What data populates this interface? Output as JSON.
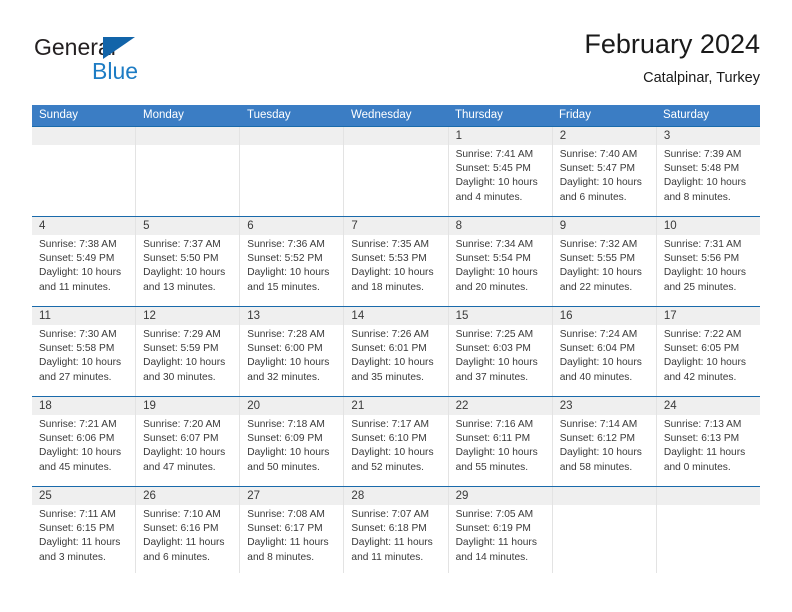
{
  "brand": {
    "name_top": "General",
    "name_bottom": "Blue",
    "accent_color": "#1d7cc4",
    "triangle_color": "#1264a9"
  },
  "header": {
    "title": "February 2024",
    "subtitle": "Catalpinar, Turkey"
  },
  "calendar": {
    "header_bg": "#3b7dc4",
    "row_rule_color": "#1a6aab",
    "date_band_bg": "#efefef",
    "weekdays": [
      "Sunday",
      "Monday",
      "Tuesday",
      "Wednesday",
      "Thursday",
      "Friday",
      "Saturday"
    ],
    "weeks": [
      [
        {
          "day": "",
          "empty": true
        },
        {
          "day": "",
          "empty": true
        },
        {
          "day": "",
          "empty": true
        },
        {
          "day": "",
          "empty": true
        },
        {
          "day": "1",
          "sunrise": "Sunrise: 7:41 AM",
          "sunset": "Sunset: 5:45 PM",
          "daylight": "Daylight: 10 hours and 4 minutes."
        },
        {
          "day": "2",
          "sunrise": "Sunrise: 7:40 AM",
          "sunset": "Sunset: 5:47 PM",
          "daylight": "Daylight: 10 hours and 6 minutes."
        },
        {
          "day": "3",
          "sunrise": "Sunrise: 7:39 AM",
          "sunset": "Sunset: 5:48 PM",
          "daylight": "Daylight: 10 hours and 8 minutes."
        }
      ],
      [
        {
          "day": "4",
          "sunrise": "Sunrise: 7:38 AM",
          "sunset": "Sunset: 5:49 PM",
          "daylight": "Daylight: 10 hours and 11 minutes."
        },
        {
          "day": "5",
          "sunrise": "Sunrise: 7:37 AM",
          "sunset": "Sunset: 5:50 PM",
          "daylight": "Daylight: 10 hours and 13 minutes."
        },
        {
          "day": "6",
          "sunrise": "Sunrise: 7:36 AM",
          "sunset": "Sunset: 5:52 PM",
          "daylight": "Daylight: 10 hours and 15 minutes."
        },
        {
          "day": "7",
          "sunrise": "Sunrise: 7:35 AM",
          "sunset": "Sunset: 5:53 PM",
          "daylight": "Daylight: 10 hours and 18 minutes."
        },
        {
          "day": "8",
          "sunrise": "Sunrise: 7:34 AM",
          "sunset": "Sunset: 5:54 PM",
          "daylight": "Daylight: 10 hours and 20 minutes."
        },
        {
          "day": "9",
          "sunrise": "Sunrise: 7:32 AM",
          "sunset": "Sunset: 5:55 PM",
          "daylight": "Daylight: 10 hours and 22 minutes."
        },
        {
          "day": "10",
          "sunrise": "Sunrise: 7:31 AM",
          "sunset": "Sunset: 5:56 PM",
          "daylight": "Daylight: 10 hours and 25 minutes."
        }
      ],
      [
        {
          "day": "11",
          "sunrise": "Sunrise: 7:30 AM",
          "sunset": "Sunset: 5:58 PM",
          "daylight": "Daylight: 10 hours and 27 minutes."
        },
        {
          "day": "12",
          "sunrise": "Sunrise: 7:29 AM",
          "sunset": "Sunset: 5:59 PM",
          "daylight": "Daylight: 10 hours and 30 minutes."
        },
        {
          "day": "13",
          "sunrise": "Sunrise: 7:28 AM",
          "sunset": "Sunset: 6:00 PM",
          "daylight": "Daylight: 10 hours and 32 minutes."
        },
        {
          "day": "14",
          "sunrise": "Sunrise: 7:26 AM",
          "sunset": "Sunset: 6:01 PM",
          "daylight": "Daylight: 10 hours and 35 minutes."
        },
        {
          "day": "15",
          "sunrise": "Sunrise: 7:25 AM",
          "sunset": "Sunset: 6:03 PM",
          "daylight": "Daylight: 10 hours and 37 minutes."
        },
        {
          "day": "16",
          "sunrise": "Sunrise: 7:24 AM",
          "sunset": "Sunset: 6:04 PM",
          "daylight": "Daylight: 10 hours and 40 minutes."
        },
        {
          "day": "17",
          "sunrise": "Sunrise: 7:22 AM",
          "sunset": "Sunset: 6:05 PM",
          "daylight": "Daylight: 10 hours and 42 minutes."
        }
      ],
      [
        {
          "day": "18",
          "sunrise": "Sunrise: 7:21 AM",
          "sunset": "Sunset: 6:06 PM",
          "daylight": "Daylight: 10 hours and 45 minutes."
        },
        {
          "day": "19",
          "sunrise": "Sunrise: 7:20 AM",
          "sunset": "Sunset: 6:07 PM",
          "daylight": "Daylight: 10 hours and 47 minutes."
        },
        {
          "day": "20",
          "sunrise": "Sunrise: 7:18 AM",
          "sunset": "Sunset: 6:09 PM",
          "daylight": "Daylight: 10 hours and 50 minutes."
        },
        {
          "day": "21",
          "sunrise": "Sunrise: 7:17 AM",
          "sunset": "Sunset: 6:10 PM",
          "daylight": "Daylight: 10 hours and 52 minutes."
        },
        {
          "day": "22",
          "sunrise": "Sunrise: 7:16 AM",
          "sunset": "Sunset: 6:11 PM",
          "daylight": "Daylight: 10 hours and 55 minutes."
        },
        {
          "day": "23",
          "sunrise": "Sunrise: 7:14 AM",
          "sunset": "Sunset: 6:12 PM",
          "daylight": "Daylight: 10 hours and 58 minutes."
        },
        {
          "day": "24",
          "sunrise": "Sunrise: 7:13 AM",
          "sunset": "Sunset: 6:13 PM",
          "daylight": "Daylight: 11 hours and 0 minutes."
        }
      ],
      [
        {
          "day": "25",
          "sunrise": "Sunrise: 7:11 AM",
          "sunset": "Sunset: 6:15 PM",
          "daylight": "Daylight: 11 hours and 3 minutes."
        },
        {
          "day": "26",
          "sunrise": "Sunrise: 7:10 AM",
          "sunset": "Sunset: 6:16 PM",
          "daylight": "Daylight: 11 hours and 6 minutes."
        },
        {
          "day": "27",
          "sunrise": "Sunrise: 7:08 AM",
          "sunset": "Sunset: 6:17 PM",
          "daylight": "Daylight: 11 hours and 8 minutes."
        },
        {
          "day": "28",
          "sunrise": "Sunrise: 7:07 AM",
          "sunset": "Sunset: 6:18 PM",
          "daylight": "Daylight: 11 hours and 11 minutes."
        },
        {
          "day": "29",
          "sunrise": "Sunrise: 7:05 AM",
          "sunset": "Sunset: 6:19 PM",
          "daylight": "Daylight: 11 hours and 14 minutes."
        },
        {
          "day": "",
          "empty": true
        },
        {
          "day": "",
          "empty": true
        }
      ]
    ]
  }
}
